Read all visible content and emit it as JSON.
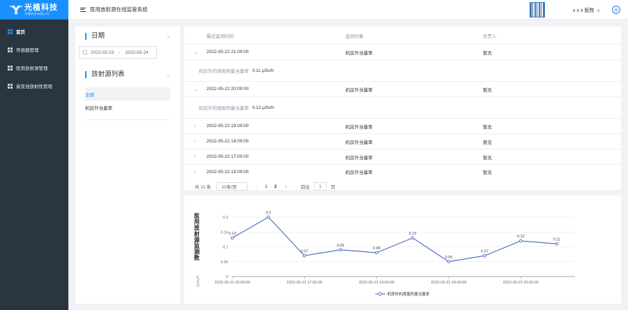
{
  "brand": {
    "title": "光植科技",
    "subtitle": "光植科技有限公司"
  },
  "sidebar": {
    "items": [
      {
        "label": "首页",
        "active": true
      },
      {
        "label": "传感器管理"
      },
      {
        "label": "医用放射源管理"
      },
      {
        "label": "衰变池放射性管理"
      }
    ]
  },
  "header": {
    "system_title": "医用放射源在线监管系统",
    "hospital": "x x x 医院",
    "chevron": "∨"
  },
  "filters": {
    "date_title": "日期",
    "date_start": "2022-02-23",
    "date_sep": "-",
    "date_end": "2022-05-24",
    "source_title": "放射源列表",
    "sources": [
      "全部",
      "机房外当量率"
    ]
  },
  "table": {
    "headers": [
      "最近监测时间",
      "监测对象",
      "负责人"
    ],
    "rows": [
      {
        "time": "2022-05-22 21:00:00",
        "object": "机房外当量率",
        "owner": "暂无",
        "expanded": true,
        "detail_label": "机房外的周围剂量当量率",
        "detail_value": "0.11 μSv/h"
      },
      {
        "time": "2022-05-22 20:00:00",
        "object": "机房外当量率",
        "owner": "暂无",
        "expanded": true,
        "detail_label": "机房外的周围剂量当量率",
        "detail_value": "0.12 μSv/h"
      },
      {
        "time": "2022-05-22 19:00:00",
        "object": "机房外当量率",
        "owner": "暂无"
      },
      {
        "time": "2022-05-22 18:00:00",
        "object": "机房外当量率",
        "owner": "暂无"
      },
      {
        "time": "2022-05-22 17:00:00",
        "object": "机房外当量率",
        "owner": "暂无"
      },
      {
        "time": "2022-05-22 15:00:00",
        "object": "机房外当量率",
        "owner": "暂无"
      }
    ]
  },
  "pagination": {
    "total": "共 11 条",
    "page_size": "10条/页",
    "pages": [
      "1",
      "2"
    ],
    "current": "1",
    "goto_label": "前往",
    "goto_value": "1",
    "goto_suffix": "页",
    "prev": "‹",
    "next": "›"
  },
  "colors": {
    "accent": "#1890ff",
    "series": "#5470c6",
    "sidebar_bg": "#2a3542"
  },
  "chart_data": {
    "type": "line",
    "ylabel": "医用放射源监测数",
    "yunit": "(μSv/h)",
    "ylim": [
      0,
      0.2
    ],
    "yticks": [
      "0",
      "0.05",
      "0.1",
      "0.15",
      "0.2"
    ],
    "xticks": [
      "2022-05-21 00:00:00",
      "2022-05-21 17:00:00",
      "2022-05-22 15:00:00",
      "2022-05-22 18:00:00",
      "2022-05-22 20:00:00"
    ],
    "series": [
      {
        "name": "机房外的周围剂量当量率",
        "x": [
          "2022-05-21 00:00:00",
          "2022-05-21 14:00:00",
          "2022-05-21 17:00:00",
          "2022-05-22 14:00:00",
          "2022-05-22 15:00:00",
          "2022-05-22 16:00:00",
          "2022-05-22 18:00:00",
          "2022-05-22 19:00:00",
          "2022-05-22 20:00:00",
          "2022-05-22 21:00:00"
        ],
        "values": [
          0.13,
          0.2,
          0.07,
          0.09,
          0.08,
          0.13,
          0.05,
          0.07,
          0.12,
          0.11
        ]
      }
    ],
    "grid": true,
    "legend": "bottom-center"
  }
}
